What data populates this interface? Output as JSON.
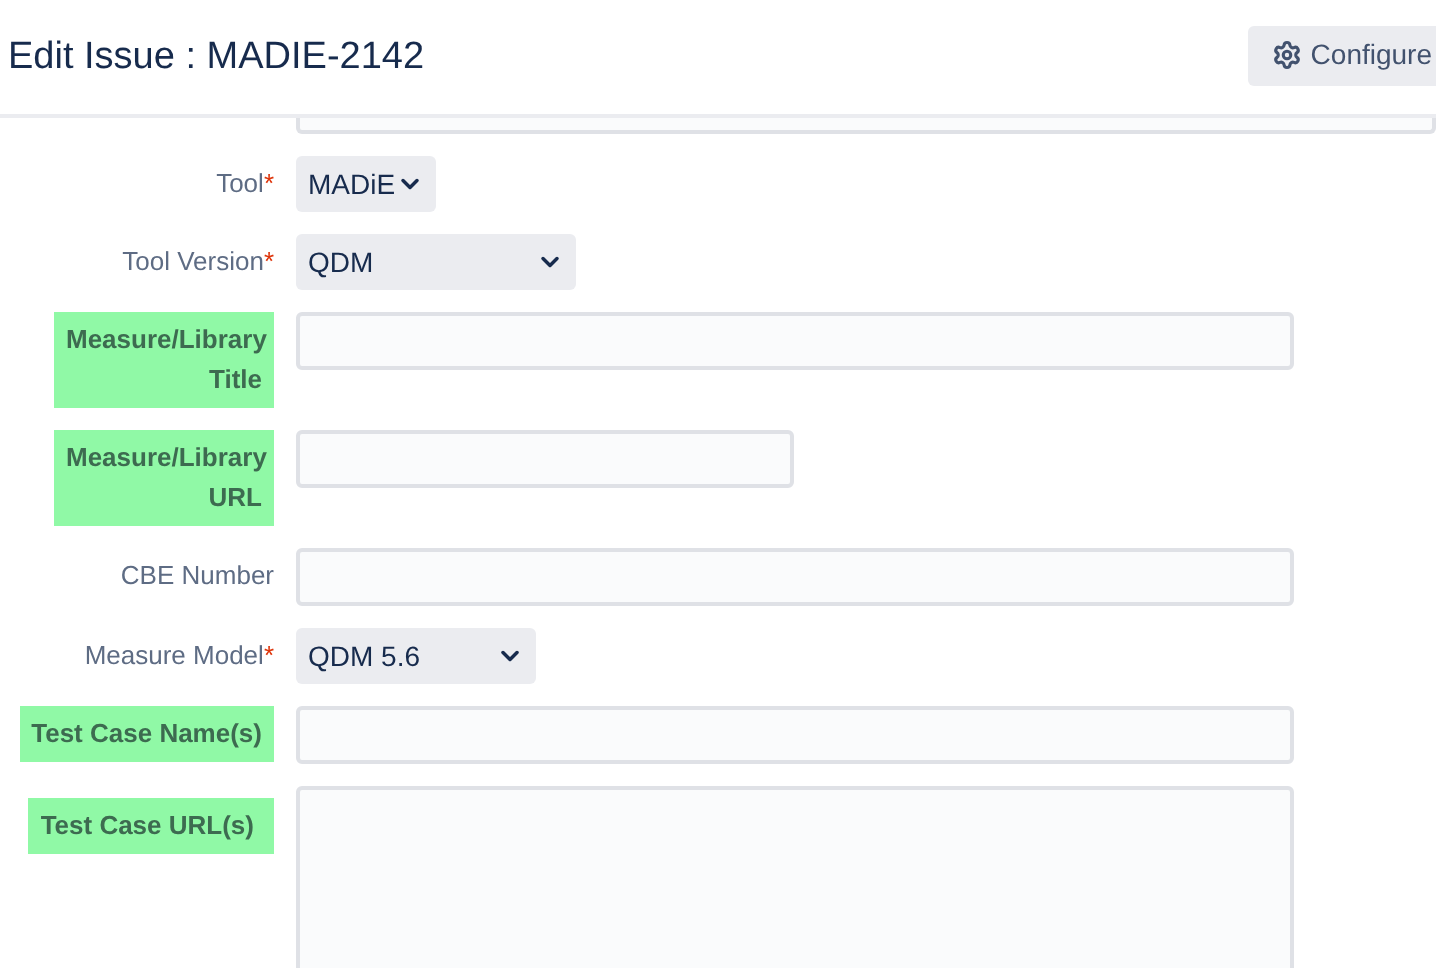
{
  "header": {
    "title": "Edit Issue : MADIE-2142",
    "configure_button": "Configure"
  },
  "fields": [
    {
      "kind": "select",
      "label": "Tool",
      "required_mark": "*",
      "highlighted": false,
      "value": "MADiE"
    },
    {
      "kind": "select",
      "label": "Tool Version",
      "required_mark": "*",
      "highlighted": false,
      "value": "QDM"
    },
    {
      "kind": "text",
      "label": "Measure/Library Title",
      "highlighted": true
    },
    {
      "kind": "text",
      "label": "Measure/Library URL",
      "highlighted": true
    },
    {
      "kind": "text",
      "label": "CBE Number",
      "highlighted": false
    },
    {
      "kind": "select",
      "label": "Measure Model",
      "required_mark": "*",
      "highlighted": false,
      "value": "QDM 5.6"
    },
    {
      "kind": "text",
      "label": "Test Case Name(s)",
      "highlighted": true
    },
    {
      "kind": "textarea",
      "label": "Test Case URL(s)",
      "highlighted": true
    }
  ]
}
